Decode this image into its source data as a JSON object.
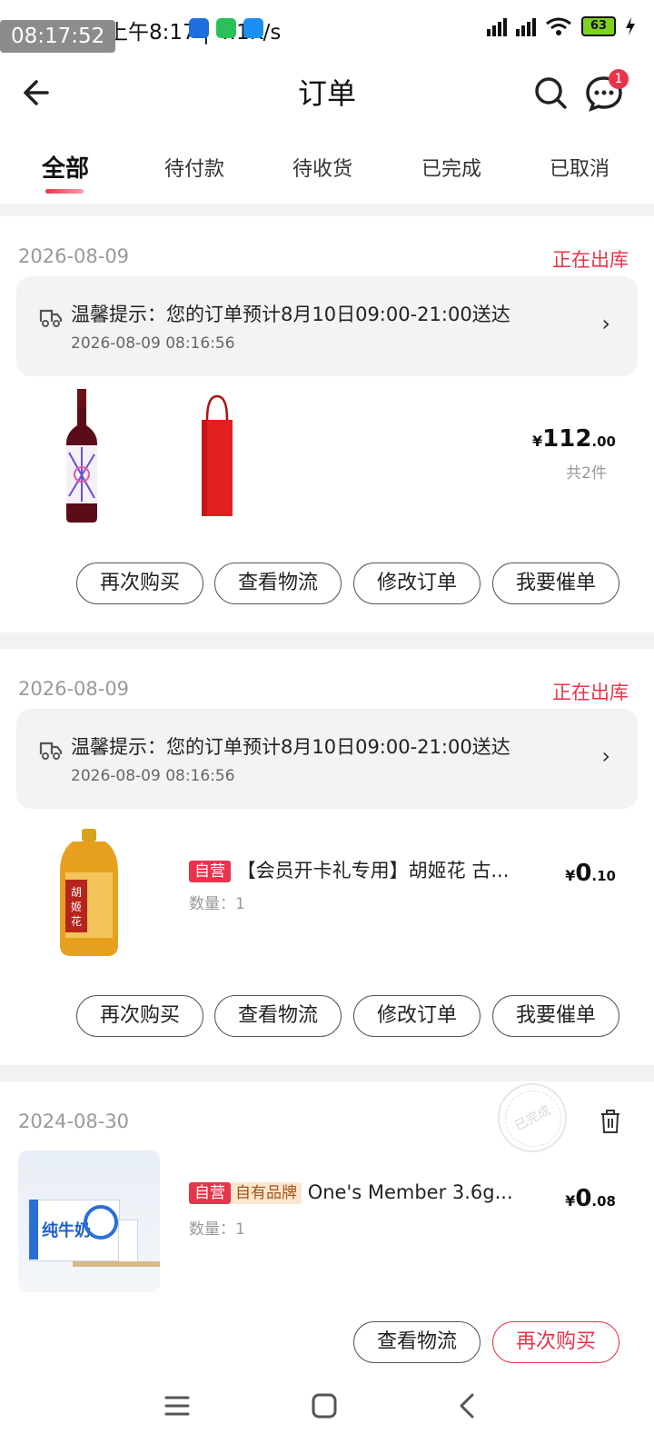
{
  "status_bar": {
    "time": "08:17:52",
    "left_text": "上午8:17 | 4.1K/s",
    "battery": "63"
  },
  "nav": {
    "title": "订单",
    "message_badge": "1"
  },
  "tabs": [
    "全部",
    "待付款",
    "待收货",
    "已完成",
    "已取消"
  ],
  "orders": [
    {
      "date": "2026-08-09",
      "status": "正在出库",
      "tip": "温馨提示：您的订单预计8月10日09:00-21:00送达",
      "tip_time": "2026-08-09 08:16:56",
      "tip_arrow": "›",
      "price_currency": "¥",
      "price_int": "112",
      "price_dec": ".00",
      "count": "共2件",
      "buttons": [
        "再次购买",
        "查看物流",
        "修改订单",
        "我要催单"
      ]
    },
    {
      "date": "2026-08-09",
      "status": "正在出库",
      "tip": "温馨提示：您的订单预计8月10日09:00-21:00送达",
      "tip_time": "2026-08-09 08:16:56",
      "tip_arrow": "›",
      "tag": "自营",
      "product": "【会员开卡礼专用】胡姬花 古...",
      "qty": "数量：1",
      "price_currency": "¥",
      "price_int": "0",
      "price_dec": ".10",
      "buttons": [
        "再次购买",
        "查看物流",
        "修改订单",
        "我要催单"
      ]
    },
    {
      "date": "2024-08-30",
      "stamp": "已完成",
      "tag": "自营",
      "brand_tag": "自有品牌",
      "product": "One's Member 3.6g...",
      "qty": "数量：1",
      "price_currency": "¥",
      "price_int": "0",
      "price_dec": ".08",
      "buttons": [
        "查看物流",
        "再次购买"
      ],
      "image_label": "纯牛奶"
    }
  ],
  "colors": {
    "accent": "#e8344a",
    "background": "#f2f2f4"
  }
}
